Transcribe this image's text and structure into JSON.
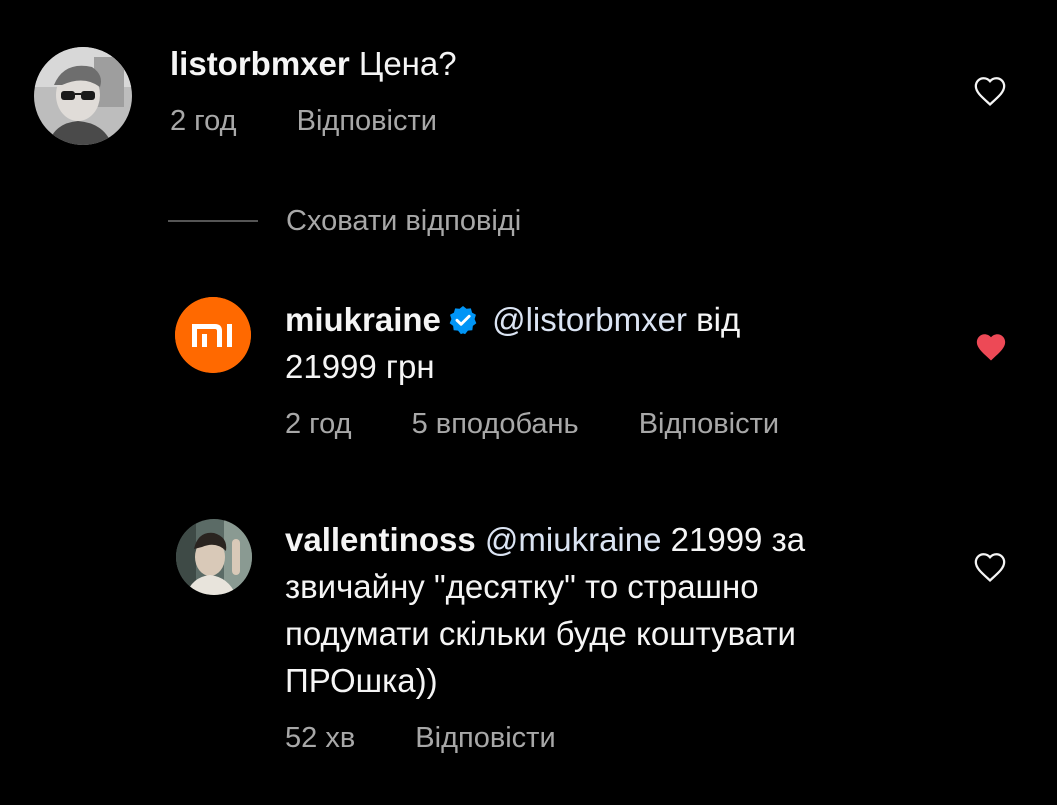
{
  "colors": {
    "background": "#000000",
    "text": "#f5f5f5",
    "meta": "#a8a8a8",
    "liked_heart": "#ed4956",
    "verified_badge": "#0095f6",
    "brand_orange": "#ff6900"
  },
  "comments": [
    {
      "username": "listorbmxer",
      "text": "Цена?",
      "time": "2 год",
      "reply_label": "Відповісти",
      "liked": false,
      "avatar_icon": "user-photo-avatar"
    },
    {
      "username": "miukraine",
      "verified": true,
      "mention": "@listorbmxer",
      "text_line1": "від",
      "text_line2": "21999 грн",
      "time": "2 год",
      "likes": "5 вподобань",
      "reply_label": "Відповісти",
      "liked": true,
      "avatar_icon": "mi-logo-avatar",
      "avatar_text": "mi"
    },
    {
      "username": "vallentinoss",
      "mention": "@miukraine",
      "text_line1": "21999 за",
      "text_line2": "звичайну \"десятку\" то страшно",
      "text_line3": "подумати скільки буде коштувати",
      "text_line4": "ПРОшка))",
      "time": "52 хв",
      "reply_label": "Відповісти",
      "liked": false,
      "avatar_icon": "user-photo-avatar"
    }
  ],
  "hide_replies_label": "Сховати відповіді"
}
